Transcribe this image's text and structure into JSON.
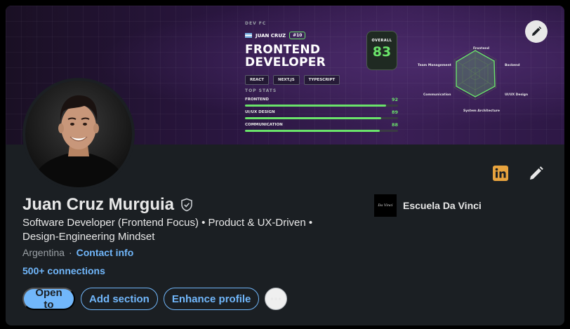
{
  "banner": {
    "team_tag": "DEV FC",
    "player_name": "JUAN CRUZ",
    "player_number": "#10",
    "title_line1": "FRONTEND",
    "title_line2": "DEVELOPER",
    "chips": [
      "REACT",
      "NEXT.JS",
      "TYPESCRIPT"
    ],
    "stats_title": "TOP STATS",
    "stats": [
      {
        "label": "FRONTEND",
        "value": 92
      },
      {
        "label": "UI/UX DESIGN",
        "value": 89
      },
      {
        "label": "COMMUNICATION",
        "value": 88
      }
    ],
    "overall_label": "OVERALL",
    "overall_value": "83",
    "radar_labels": {
      "top": "Frontend",
      "top_right": "Backend",
      "bottom_right": "UI/UX Design",
      "bottom": "System Architecture",
      "bottom_left": "Communication",
      "top_left": "Team Management"
    },
    "accent_color": "#6ae36a"
  },
  "profile": {
    "name": "Juan Cruz Murguia",
    "headline": "Software Developer (Frontend Focus) • Product & UX-Driven • Design-Engineering Mindset",
    "location": "Argentina",
    "separator": "·",
    "contact_info": "Contact info",
    "connections": "500+ connections",
    "verified_icon": "shield-check-icon"
  },
  "education": {
    "name": "Escuela Da Vinci",
    "logo_text": "Da Vinci"
  },
  "actions": {
    "open_to": "Open to",
    "add_section": "Add section",
    "enhance_profile": "Enhance profile",
    "more": "•••"
  },
  "icons": {
    "banner_edit": "pencil-icon",
    "linkedin": "linkedin-icon",
    "edit_intro": "pencil-icon"
  },
  "colors": {
    "link": "#71b7fb",
    "card_bg": "#1b1f23",
    "text": "#e8e8e8",
    "muted": "#9ba1a6",
    "linkedin_brand": "#e7a33e"
  }
}
